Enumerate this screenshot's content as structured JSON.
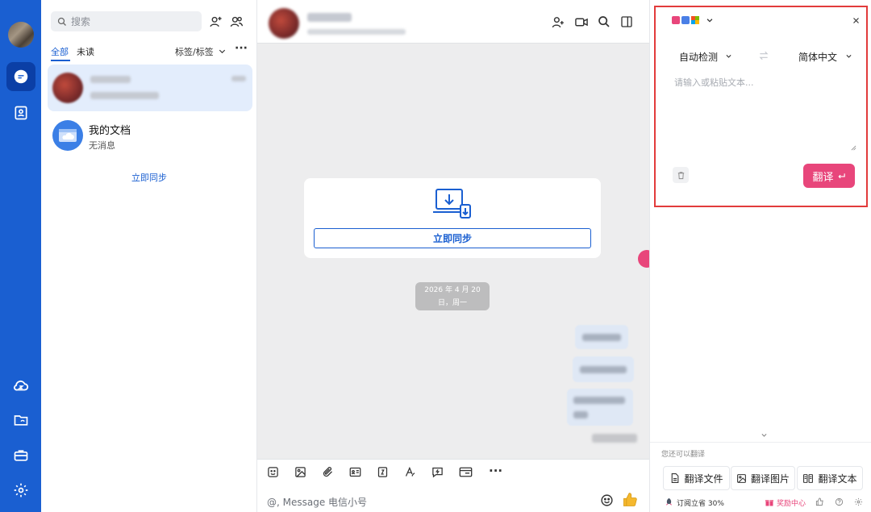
{
  "sidebar": {
    "items": [
      {
        "name": "chat",
        "active": true
      },
      {
        "name": "contacts",
        "active": false
      },
      {
        "name": "cloud",
        "active": false
      },
      {
        "name": "folder",
        "active": false
      },
      {
        "name": "toolbox",
        "active": false
      },
      {
        "name": "settings",
        "active": false
      }
    ],
    "accent_color": "#1a5fd1"
  },
  "conversations": {
    "search_placeholder": "搜索",
    "tabs": [
      {
        "label": "全部",
        "active": true
      },
      {
        "label": "未读",
        "active": false
      }
    ],
    "filter_label": "标签/标签",
    "items": [
      {
        "title": "",
        "subtitle": "",
        "selected": true,
        "blurred": true
      },
      {
        "title": "我的文档",
        "subtitle": "无消息",
        "selected": false,
        "blurred": false
      }
    ],
    "sync_link": "立即同步"
  },
  "chat": {
    "sync_button": "立即同步",
    "date_line1": "2026 年 4 月 20",
    "date_line2": "日，周一",
    "compose_placeholder": "@, Message 电信小号"
  },
  "translator": {
    "source_lang": "自动检测",
    "target_lang": "简体中文",
    "input_placeholder": "请输入或粘贴文本...",
    "translate_button": "翻译",
    "also_label": "您还可以翻译",
    "functions": [
      {
        "label": "翻译文件",
        "icon": "file-icon"
      },
      {
        "label": "翻译图片",
        "icon": "image-icon"
      },
      {
        "label": "翻译文本",
        "icon": "text-doc-icon"
      }
    ],
    "subscribe_label": "订阅立省 30%",
    "rewards_label": "奖励中心",
    "accent_color": "#e8467b",
    "highlight_color": "#e23b3b"
  }
}
